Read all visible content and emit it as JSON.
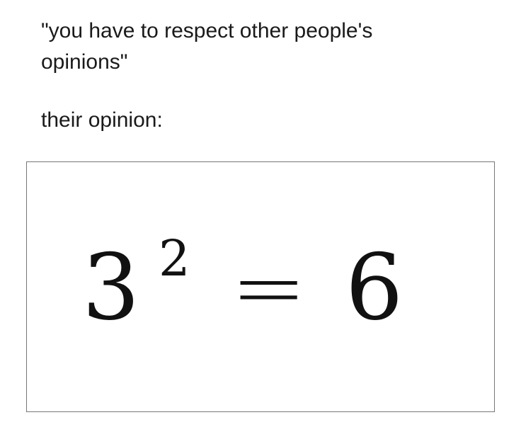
{
  "caption": {
    "quote_line_1": "\"you have to respect other people's",
    "quote_line_2": "opinions\"",
    "opinion_label": "their opinion:"
  },
  "equation": {
    "base": "3",
    "exponent": "2",
    "operator": "=",
    "result": "6"
  }
}
